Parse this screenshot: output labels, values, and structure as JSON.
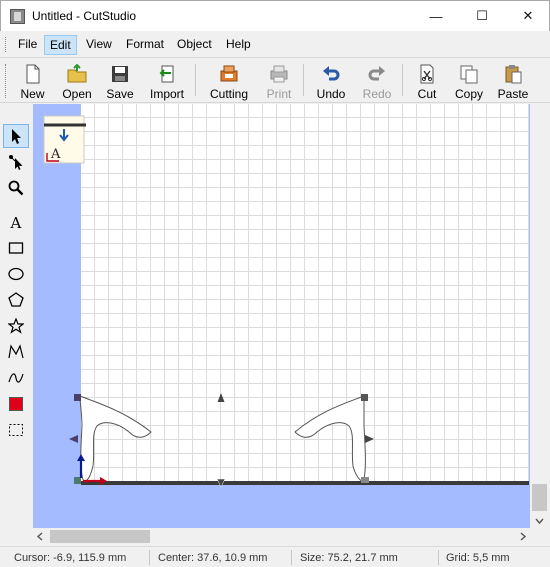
{
  "window": {
    "title": "Untitled - CutStudio",
    "controls": {
      "minimize": "—",
      "maximize": "☐",
      "close": "✕"
    }
  },
  "menu": [
    "File",
    "Edit",
    "View",
    "Format",
    "Object",
    "Help"
  ],
  "menu_active": "Edit",
  "toolbar": {
    "new": "New",
    "open": "Open",
    "save": "Save",
    "import": "Import",
    "cutting": "Cutting",
    "print": "Print",
    "undo": "Undo",
    "redo": "Redo",
    "cut": "Cut",
    "copy": "Copy",
    "paste": "Paste"
  },
  "tools": [
    "select-arrow-icon",
    "node-edit-icon",
    "zoom-icon",
    "text-icon",
    "rectangle-icon",
    "ellipse-icon",
    "polygon-icon",
    "star-icon",
    "polyline-icon",
    "bezier-curve-icon",
    "color-fill-icon",
    "selection-frame-icon"
  ],
  "colors": {
    "workspace": "#a4bcff",
    "accent": "#cce4f7",
    "selection_handle": "#4a3f6b",
    "fill_swatch": "#e0001a",
    "baseline": "#3a3a3a"
  },
  "status": {
    "cursor": "Cursor: -6.9, 115.9 mm",
    "center": "Center: 37.6, 10.9 mm",
    "size": "Size: 75.2, 21.7 mm",
    "grid": "Grid: 5,5 mm"
  }
}
